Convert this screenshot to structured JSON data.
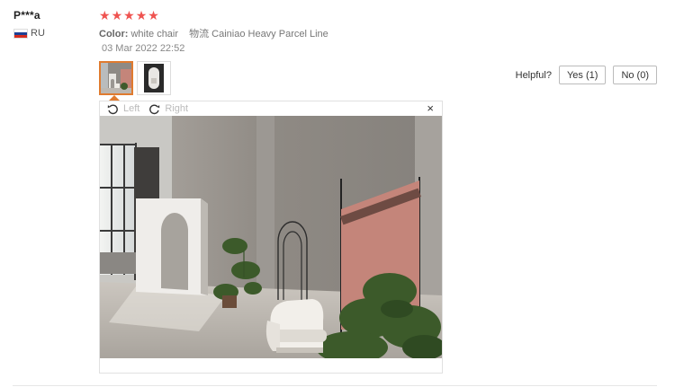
{
  "review": {
    "user_name": "P***a",
    "country": "RU",
    "rating": 5,
    "color_label": "Color:",
    "color_value": "white chair",
    "shipping": "物流 Cainiao Heavy Parcel Line",
    "date": "03 Mar 2022 22:52"
  },
  "helpful": {
    "label": "Helpful?",
    "yes_label": "Yes (1)",
    "no_label": "No (0)"
  },
  "viewer": {
    "rotate_left": "Left",
    "rotate_right": "Right",
    "close_label": "×"
  },
  "icons": {
    "star": "star-icon",
    "flag": "russia-flag-icon",
    "rotate_left": "rotate-left-icon",
    "rotate_right": "rotate-right-icon",
    "close": "close-icon"
  },
  "colors": {
    "star": "#ef5350",
    "thumb_active_border": "#e07b2f",
    "backdrop": "#c4857a"
  }
}
